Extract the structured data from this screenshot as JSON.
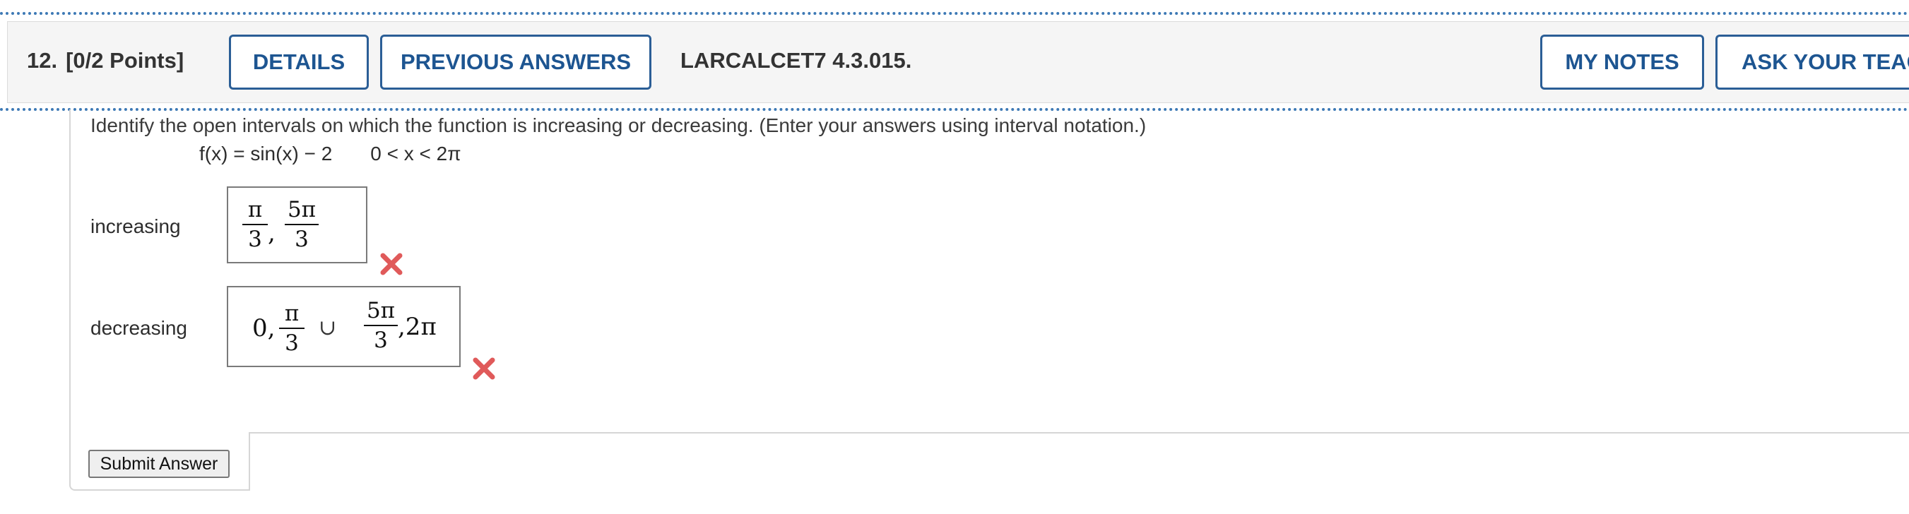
{
  "header": {
    "question_number": "12.",
    "points": "[0/2 Points]",
    "details_label": "DETAILS",
    "previous_answers_label": "PREVIOUS ANSWERS",
    "question_id": "LARCALCET7 4.3.015.",
    "my_notes_label": "MY NOTES",
    "ask_teacher_label": "ASK YOUR TEAC"
  },
  "question": {
    "prompt": "Identify the open intervals on which the function is increasing or decreasing. (Enter your answers using interval notation.)",
    "function_lhs": "f(x) = sin(x) − 2",
    "domain": "0 < x < 2π"
  },
  "answers": {
    "increasing": {
      "label": "increasing",
      "frac1_num": "π",
      "frac1_den": "3",
      "separator": ",",
      "frac2_num": "5π",
      "frac2_den": "3",
      "status": "incorrect"
    },
    "decreasing": {
      "label": "decreasing",
      "lead": "0,",
      "frac1_num": "π",
      "frac1_den": "3",
      "union": "∪",
      "frac2_num": "5π",
      "frac2_den": "3",
      "tail": ",2π",
      "status": "incorrect"
    }
  },
  "submit": {
    "label": "Submit Answer"
  },
  "colors": {
    "header_bg": "#f5f5f5",
    "button_border": "#2b5e96",
    "button_text": "#1d5591",
    "dots": "#3d79b5",
    "error_x": "#e05a5a"
  },
  "icons": {
    "incorrect": "x-mark-icon"
  }
}
